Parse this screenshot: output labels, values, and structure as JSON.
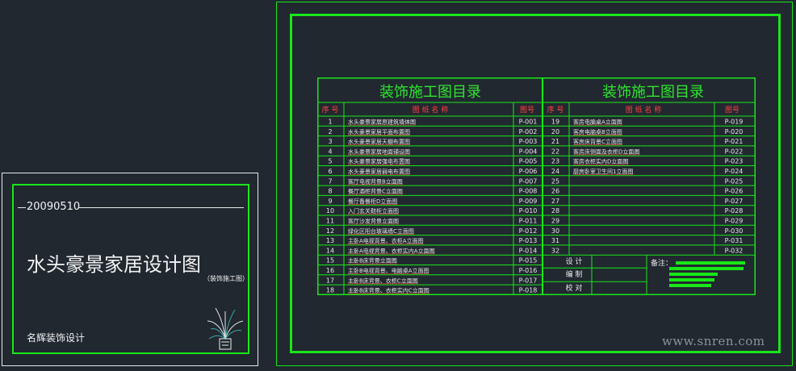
{
  "cover": {
    "date": "20090510",
    "title": "水头豪景家居设计图",
    "subtitle": "（装饰施工图）",
    "company": "名辉装饰设计"
  },
  "toc": {
    "title_left": "装饰施工图目录",
    "title_right": "装饰施工图目录",
    "col_index": "序 号",
    "col_name": "图 纸 名 称",
    "col_code": "图号",
    "left_rows": [
      {
        "n": "1",
        "name": "水头豪景家居原建筑墙体图",
        "code": "P-001"
      },
      {
        "n": "2",
        "name": "水头豪景家居平面布置图",
        "code": "P-002"
      },
      {
        "n": "3",
        "name": "水头豪景家居天棚布置图",
        "code": "P-003"
      },
      {
        "n": "4",
        "name": "水头豪景家居地面铺设图",
        "code": "P-004"
      },
      {
        "n": "5",
        "name": "水头豪景家居强电布置图",
        "code": "P-005"
      },
      {
        "n": "6",
        "name": "水头豪景家居弱电布置图",
        "code": "P-006"
      },
      {
        "n": "7",
        "name": "客厅电视背景B立面图",
        "code": "P-007"
      },
      {
        "n": "8",
        "name": "餐厅酒柜背景C立面图",
        "code": "P-008"
      },
      {
        "n": "9",
        "name": "餐厅备餐柜D立面图",
        "code": "P-009"
      },
      {
        "n": "10",
        "name": "入门玄关鞋柜立面图",
        "code": "P-010"
      },
      {
        "n": "11",
        "name": "客厅沙发背景立面图",
        "code": "P-011"
      },
      {
        "n": "12",
        "name": "绿化区阳台玻璃墙C立面图",
        "code": "P-012"
      },
      {
        "n": "13",
        "name": "主卧A电视背景、衣柜A立面图",
        "code": "P-013"
      },
      {
        "n": "14",
        "name": "主卧A电视背景、衣柜实内A立面图",
        "code": "P-014"
      },
      {
        "n": "15",
        "name": "主卧B床背景立面图",
        "code": "P-015"
      },
      {
        "n": "16",
        "name": "主卧B电视背景、电脑桌A立面图",
        "code": "P-016"
      },
      {
        "n": "17",
        "name": "主卧B床背景、衣柜C立面图",
        "code": "P-017"
      },
      {
        "n": "18",
        "name": "主卧B床背景、衣柜实内C立面图",
        "code": "P-018"
      }
    ],
    "right_rows": [
      {
        "n": "19",
        "name": "客房电脑桌A立面图",
        "code": "P-019"
      },
      {
        "n": "20",
        "name": "客房电脑桌B立面图",
        "code": "P-020"
      },
      {
        "n": "21",
        "name": "客房床背景C立面图",
        "code": "P-021"
      },
      {
        "n": "22",
        "name": "客房床侧面及衣柜D立面图",
        "code": "P-022"
      },
      {
        "n": "23",
        "name": "客房衣柜实内D立面图",
        "code": "P-023"
      },
      {
        "n": "24",
        "name": "厨房卧室卫生间1立面图",
        "code": "P-024"
      },
      {
        "n": "25",
        "name": "",
        "code": "P-025"
      },
      {
        "n": "26",
        "name": "",
        "code": "P-026"
      },
      {
        "n": "27",
        "name": "",
        "code": "P-027"
      },
      {
        "n": "28",
        "name": "",
        "code": "P-028"
      },
      {
        "n": "29",
        "name": "",
        "code": "P-029"
      },
      {
        "n": "30",
        "name": "",
        "code": "P-030"
      },
      {
        "n": "31",
        "name": "",
        "code": "P-031"
      },
      {
        "n": "32",
        "name": "",
        "code": "P-032"
      }
    ],
    "sign": {
      "design": "设  计",
      "draw": "编  制",
      "check": "校  对",
      "remark": "备注："
    }
  },
  "watermark": "www.snren.com",
  "colors": {
    "background": "#212830",
    "cad_green": "#19e619",
    "title_green": "#2ee62e",
    "red": "#ff4040",
    "white": "#e8e8e8"
  }
}
